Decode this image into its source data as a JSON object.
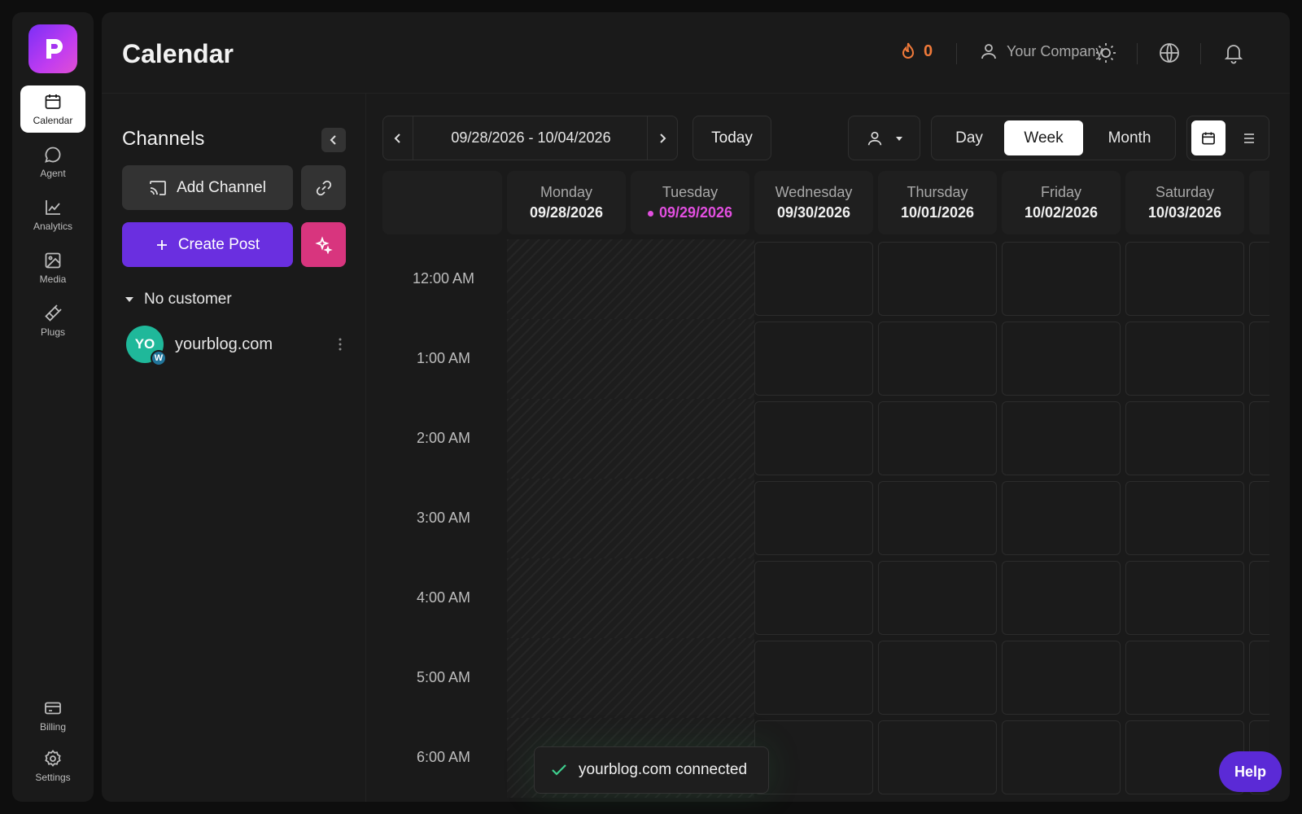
{
  "app": {
    "logo_letter": "p",
    "accent": "#6a2fe0",
    "brand_gradient": [
      "#7b2ff7",
      "#e04fd3"
    ]
  },
  "rail": {
    "items": [
      {
        "label": "Calendar",
        "icon": "calendar-icon",
        "active": true
      },
      {
        "label": "Agent",
        "icon": "chat-bubble-icon"
      },
      {
        "label": "Analytics",
        "icon": "line-chart-icon"
      },
      {
        "label": "Media",
        "icon": "image-icon"
      },
      {
        "label": "Plugs",
        "icon": "plug-icon"
      }
    ],
    "bottom_items": [
      {
        "label": "Billing",
        "icon": "credit-card-icon"
      },
      {
        "label": "Settings",
        "icon": "gear-icon"
      }
    ]
  },
  "header": {
    "title": "Calendar",
    "streak_count": "0",
    "company": "Your Company"
  },
  "channels": {
    "title": "Channels",
    "add_channel_label": "Add Channel",
    "create_post_label": "Create Post",
    "customer_group": "No customer",
    "list": [
      {
        "initials": "YO",
        "badge": "W",
        "name": "yourblog.com"
      }
    ]
  },
  "calendar": {
    "date_range": "09/28/2026 - 10/04/2026",
    "today_label": "Today",
    "views": [
      "Day",
      "Week",
      "Month"
    ],
    "active_view": "Week",
    "days": [
      {
        "name": "Monday",
        "date": "09/28/2026"
      },
      {
        "name": "Tuesday",
        "date": "09/29/2026",
        "today": true
      },
      {
        "name": "Wednesday",
        "date": "09/30/2026"
      },
      {
        "name": "Thursday",
        "date": "10/01/2026"
      },
      {
        "name": "Friday",
        "date": "10/02/2026"
      },
      {
        "name": "Saturday",
        "date": "10/03/2026"
      }
    ],
    "hours": [
      "12:00 AM",
      "1:00 AM",
      "2:00 AM",
      "3:00 AM",
      "4:00 AM",
      "5:00 AM",
      "6:00 AM"
    ]
  },
  "toast": {
    "message": "yourblog.com connected"
  },
  "help_label": "Help"
}
